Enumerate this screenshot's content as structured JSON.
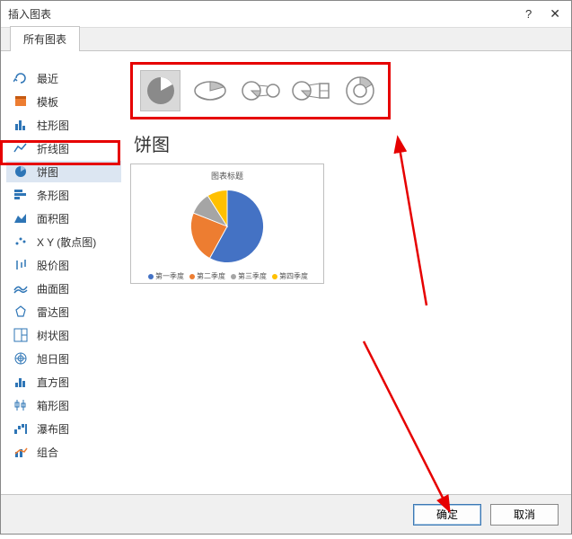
{
  "window_title": "插入图表",
  "tabs": {
    "all_charts": "所有图表"
  },
  "sidebar": {
    "items": [
      {
        "id": "recent",
        "label": "最近",
        "color": "#2e75b6"
      },
      {
        "id": "templates",
        "label": "模板",
        "color": "#ed7d31"
      },
      {
        "id": "column",
        "label": "柱形图",
        "color": "#2e75b6"
      },
      {
        "id": "line",
        "label": "折线图",
        "color": "#2e75b6"
      },
      {
        "id": "pie",
        "label": "饼图",
        "color": "#2e75b6",
        "selected": true
      },
      {
        "id": "bar",
        "label": "条形图",
        "color": "#2e75b6"
      },
      {
        "id": "area",
        "label": "面积图",
        "color": "#2e75b6"
      },
      {
        "id": "xy",
        "label": "X Y (散点图)",
        "color": "#2e75b6"
      },
      {
        "id": "stock",
        "label": "股价图",
        "color": "#2e75b6"
      },
      {
        "id": "surface",
        "label": "曲面图",
        "color": "#2e75b6"
      },
      {
        "id": "radar",
        "label": "雷达图",
        "color": "#2e75b6"
      },
      {
        "id": "treemap",
        "label": "树状图",
        "color": "#2e75b6"
      },
      {
        "id": "sunburst",
        "label": "旭日图",
        "color": "#2e75b6"
      },
      {
        "id": "histogram",
        "label": "直方图",
        "color": "#2e75b6"
      },
      {
        "id": "boxwhisker",
        "label": "箱形图",
        "color": "#2e75b6"
      },
      {
        "id": "waterfall",
        "label": "瀑布图",
        "color": "#2e75b6"
      },
      {
        "id": "combo",
        "label": "组合",
        "color": "#2e75b6"
      }
    ]
  },
  "selected_chart_name": "饼图",
  "preview_title": "图表标题",
  "legend_items": [
    {
      "label": "第一季度",
      "color": "#4472C4"
    },
    {
      "label": "第二季度",
      "color": "#ED7D31"
    },
    {
      "label": "第三季度",
      "color": "#A5A5A5"
    },
    {
      "label": "第四季度",
      "color": "#FFC000"
    }
  ],
  "buttons": {
    "ok": "确定",
    "cancel": "取消"
  },
  "chart_data": {
    "type": "pie",
    "title": "图表标题",
    "categories": [
      "第一季度",
      "第二季度",
      "第三季度",
      "第四季度"
    ],
    "values": [
      58,
      23,
      10,
      9
    ],
    "colors": [
      "#4472C4",
      "#ED7D31",
      "#A5A5A5",
      "#FFC000"
    ]
  }
}
